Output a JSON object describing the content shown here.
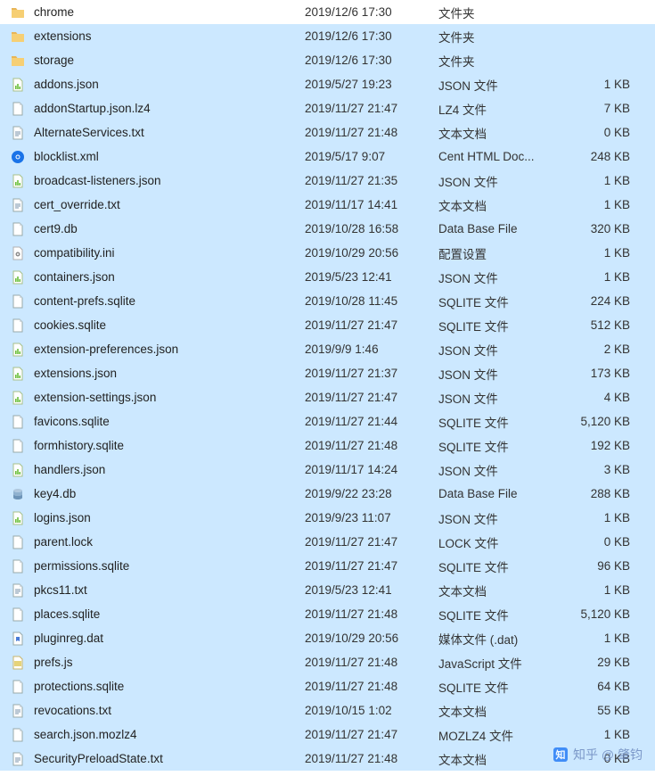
{
  "watermark": "知乎 @ 肇钧",
  "rows": [
    {
      "icon": "folder",
      "name": "chrome",
      "date": "2019/12/6 17:30",
      "type": "文件夹",
      "size": ""
    },
    {
      "icon": "folder",
      "name": "extensions",
      "date": "2019/12/6 17:30",
      "type": "文件夹",
      "size": ""
    },
    {
      "icon": "folder",
      "name": "storage",
      "date": "2019/12/6 17:30",
      "type": "文件夹",
      "size": ""
    },
    {
      "icon": "json",
      "name": "addons.json",
      "date": "2019/5/27 19:23",
      "type": "JSON 文件",
      "size": "1 KB"
    },
    {
      "icon": "file",
      "name": "addonStartup.json.lz4",
      "date": "2019/11/27 21:47",
      "type": "LZ4 文件",
      "size": "7 KB"
    },
    {
      "icon": "txt",
      "name": "AlternateServices.txt",
      "date": "2019/11/27 21:48",
      "type": "文本文档",
      "size": "0 KB"
    },
    {
      "icon": "html",
      "name": "blocklist.xml",
      "date": "2019/5/17 9:07",
      "type": "Cent HTML Doc...",
      "size": "248 KB"
    },
    {
      "icon": "json",
      "name": "broadcast-listeners.json",
      "date": "2019/11/27 21:35",
      "type": "JSON 文件",
      "size": "1 KB"
    },
    {
      "icon": "txt",
      "name": "cert_override.txt",
      "date": "2019/11/17 14:41",
      "type": "文本文档",
      "size": "1 KB"
    },
    {
      "icon": "file",
      "name": "cert9.db",
      "date": "2019/10/28 16:58",
      "type": "Data Base File",
      "size": "320 KB"
    },
    {
      "icon": "ini",
      "name": "compatibility.ini",
      "date": "2019/10/29 20:56",
      "type": "配置设置",
      "size": "1 KB"
    },
    {
      "icon": "json",
      "name": "containers.json",
      "date": "2019/5/23 12:41",
      "type": "JSON 文件",
      "size": "1 KB"
    },
    {
      "icon": "file",
      "name": "content-prefs.sqlite",
      "date": "2019/10/28 11:45",
      "type": "SQLITE 文件",
      "size": "224 KB"
    },
    {
      "icon": "file",
      "name": "cookies.sqlite",
      "date": "2019/11/27 21:47",
      "type": "SQLITE 文件",
      "size": "512 KB"
    },
    {
      "icon": "json",
      "name": "extension-preferences.json",
      "date": "2019/9/9 1:46",
      "type": "JSON 文件",
      "size": "2 KB"
    },
    {
      "icon": "json",
      "name": "extensions.json",
      "date": "2019/11/27 21:37",
      "type": "JSON 文件",
      "size": "173 KB"
    },
    {
      "icon": "json",
      "name": "extension-settings.json",
      "date": "2019/11/27 21:47",
      "type": "JSON 文件",
      "size": "4 KB"
    },
    {
      "icon": "file",
      "name": "favicons.sqlite",
      "date": "2019/11/27 21:44",
      "type": "SQLITE 文件",
      "size": "5,120 KB"
    },
    {
      "icon": "file",
      "name": "formhistory.sqlite",
      "date": "2019/11/27 21:48",
      "type": "SQLITE 文件",
      "size": "192 KB"
    },
    {
      "icon": "json",
      "name": "handlers.json",
      "date": "2019/11/17 14:24",
      "type": "JSON 文件",
      "size": "3 KB"
    },
    {
      "icon": "db",
      "name": "key4.db",
      "date": "2019/9/22 23:28",
      "type": "Data Base File",
      "size": "288 KB"
    },
    {
      "icon": "json",
      "name": "logins.json",
      "date": "2019/9/23 11:07",
      "type": "JSON 文件",
      "size": "1 KB"
    },
    {
      "icon": "file",
      "name": "parent.lock",
      "date": "2019/11/27 21:47",
      "type": "LOCK 文件",
      "size": "0 KB"
    },
    {
      "icon": "file",
      "name": "permissions.sqlite",
      "date": "2019/11/27 21:47",
      "type": "SQLITE 文件",
      "size": "96 KB"
    },
    {
      "icon": "txt",
      "name": "pkcs11.txt",
      "date": "2019/5/23 12:41",
      "type": "文本文档",
      "size": "1 KB"
    },
    {
      "icon": "file",
      "name": "places.sqlite",
      "date": "2019/11/27 21:48",
      "type": "SQLITE 文件",
      "size": "5,120 KB"
    },
    {
      "icon": "dat",
      "name": "pluginreg.dat",
      "date": "2019/10/29 20:56",
      "type": "媒体文件 (.dat)",
      "size": "1 KB"
    },
    {
      "icon": "js",
      "name": "prefs.js",
      "date": "2019/11/27 21:48",
      "type": "JavaScript 文件",
      "size": "29 KB"
    },
    {
      "icon": "file",
      "name": "protections.sqlite",
      "date": "2019/11/27 21:48",
      "type": "SQLITE 文件",
      "size": "64 KB"
    },
    {
      "icon": "txt",
      "name": "revocations.txt",
      "date": "2019/10/15 1:02",
      "type": "文本文档",
      "size": "55 KB"
    },
    {
      "icon": "file",
      "name": "search.json.mozlz4",
      "date": "2019/11/27 21:47",
      "type": "MOZLZ4 文件",
      "size": "1 KB"
    },
    {
      "icon": "txt",
      "name": "SecurityPreloadState.txt",
      "date": "2019/11/27 21:48",
      "type": "文本文档",
      "size": "0 KB"
    }
  ]
}
